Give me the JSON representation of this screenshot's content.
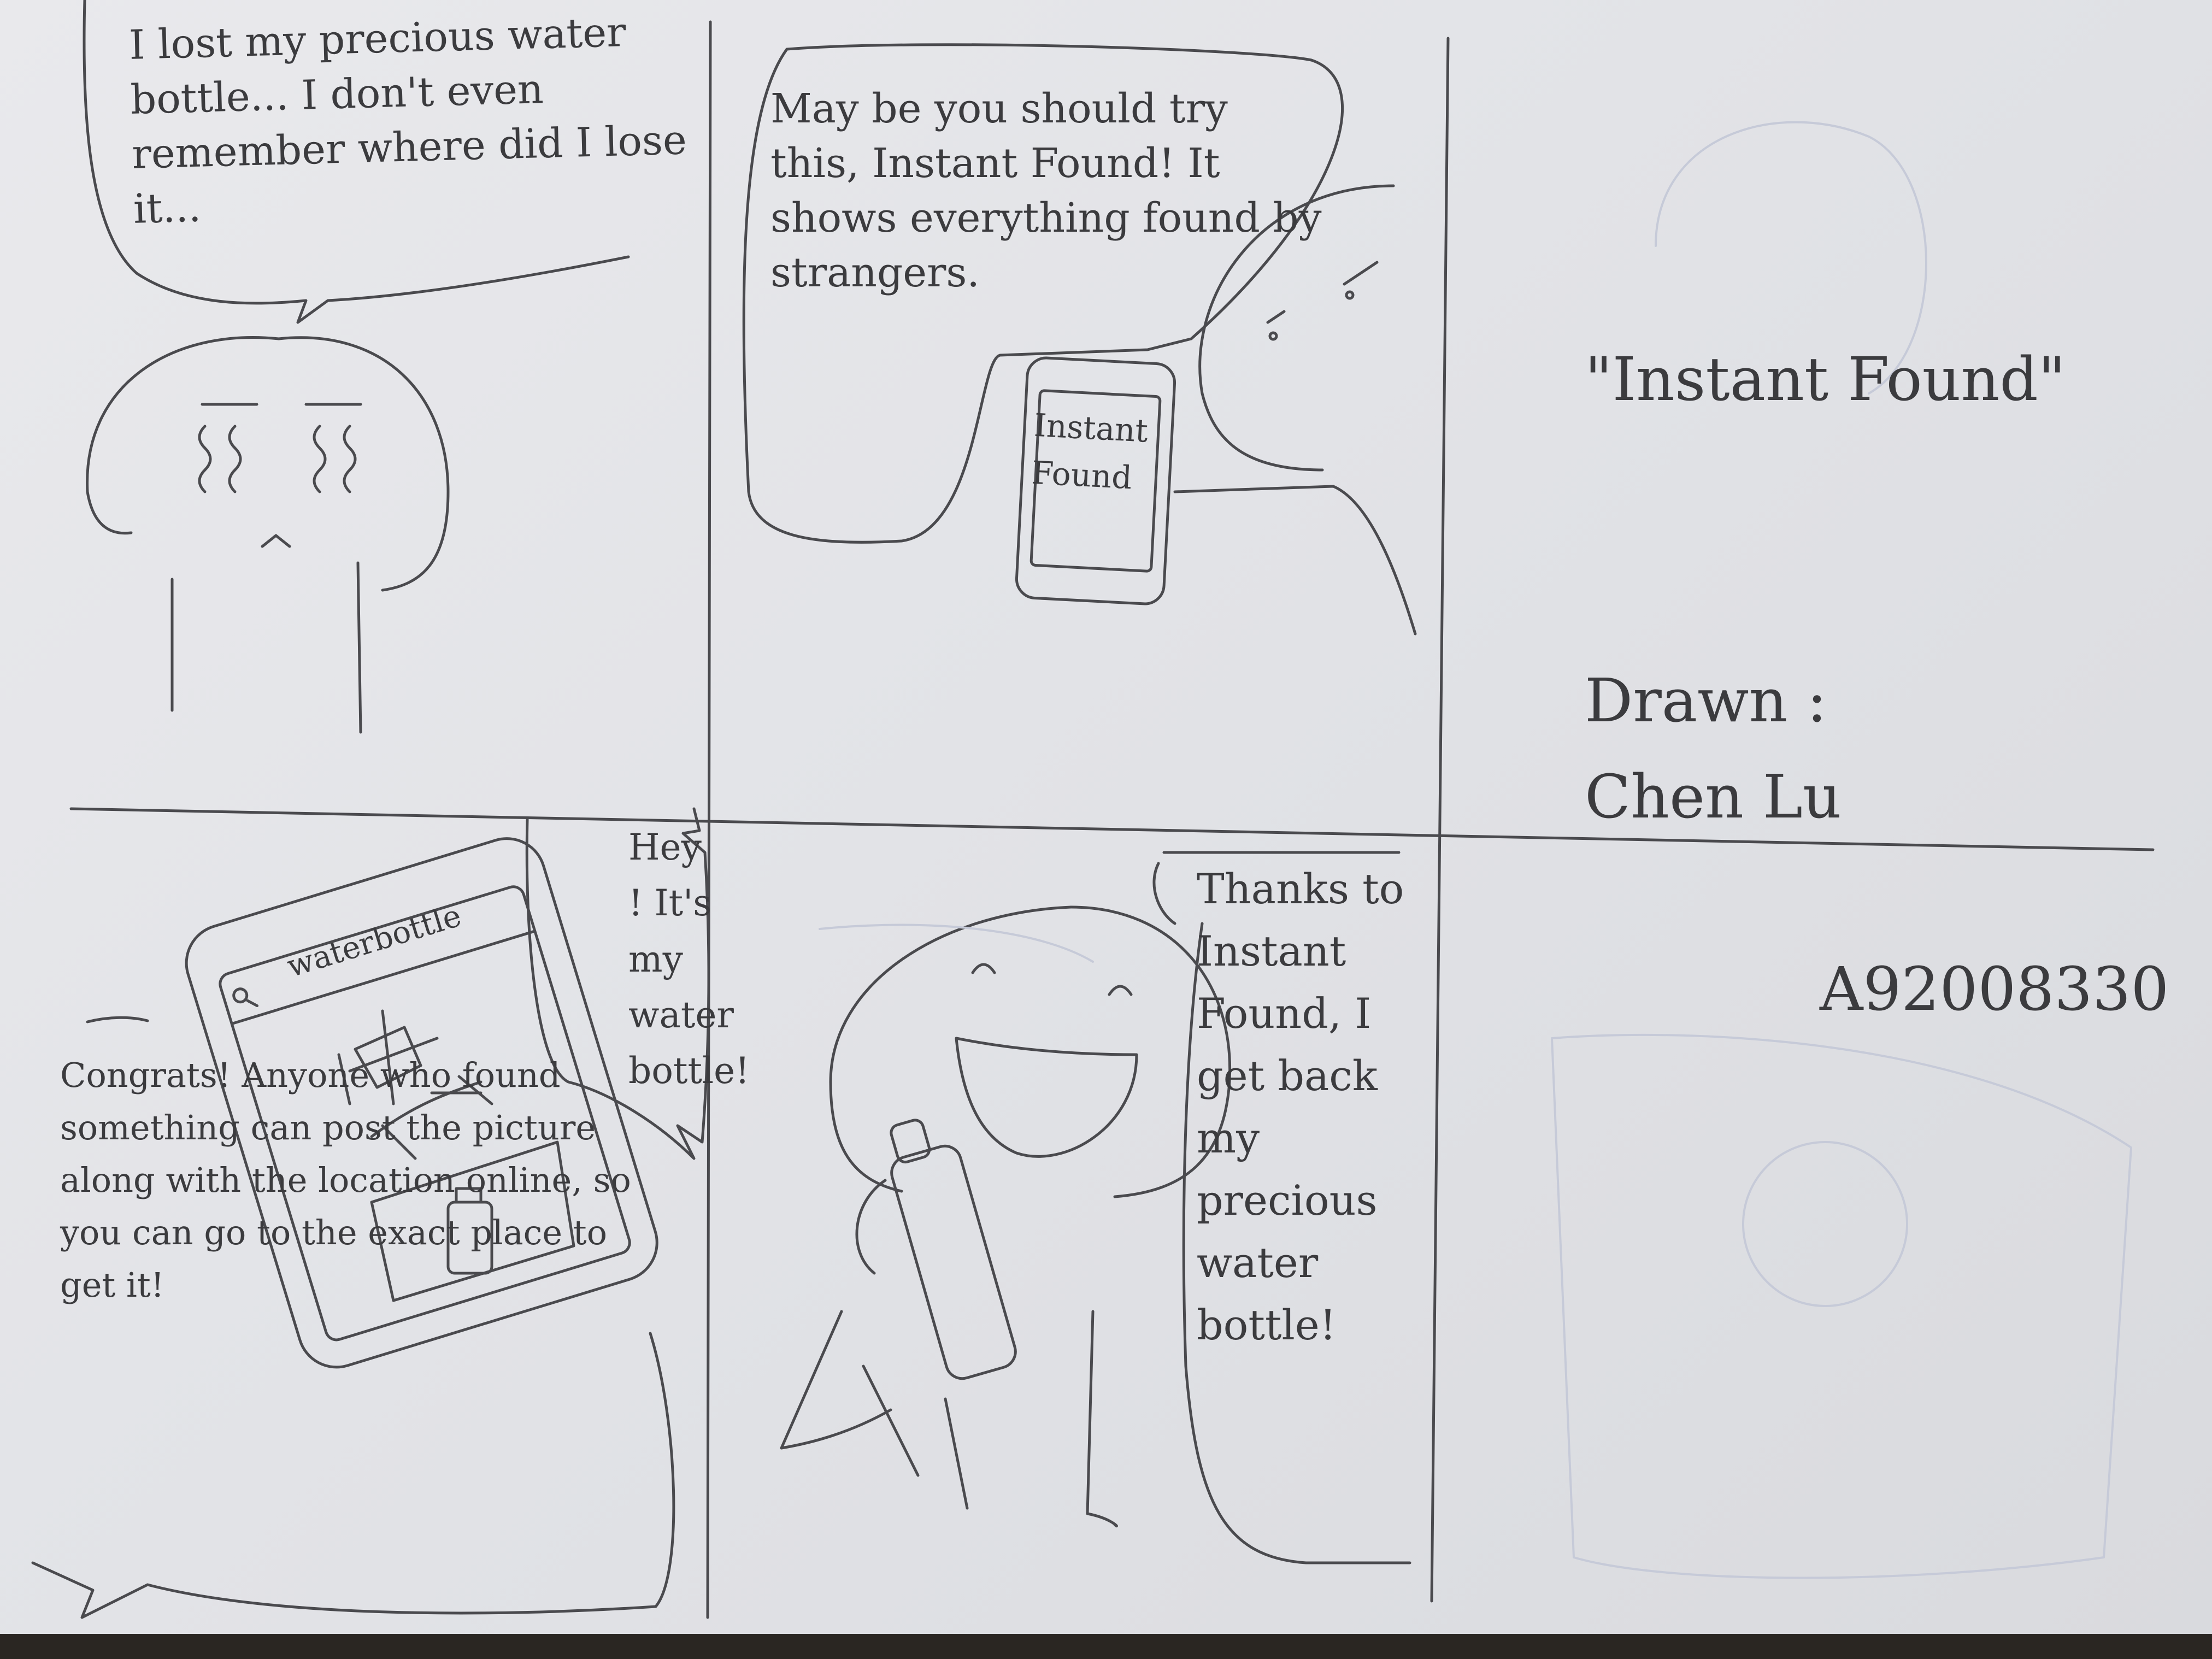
{
  "comic": {
    "panel1": {
      "speech": "I lost my precious water bottle... I don't even remember where did I lose it..."
    },
    "panel2": {
      "speech": "May be you should try this, Instant Found! It shows everything found by strangers.",
      "phone_label": "Instant Found"
    },
    "panel3": {
      "title": "\"Instant Found\"",
      "drawn_label": "Drawn :",
      "author": "Chen Lu",
      "id": "A92008330"
    },
    "panel4": {
      "search_text": "waterbottle",
      "speech_right": "Hey ! It's my water bottle!",
      "speech_left": "Congrats! Anyone who found something can post the picture along with the location online, so you can go to the exact place to get it!"
    },
    "panel5": {
      "speech": "Thanks to Instant Found, I get back my precious water bottle!"
    }
  },
  "colors": {
    "paper": "#e4e5e9",
    "pencil": "#3b3b3e",
    "table": "#2a2622"
  }
}
